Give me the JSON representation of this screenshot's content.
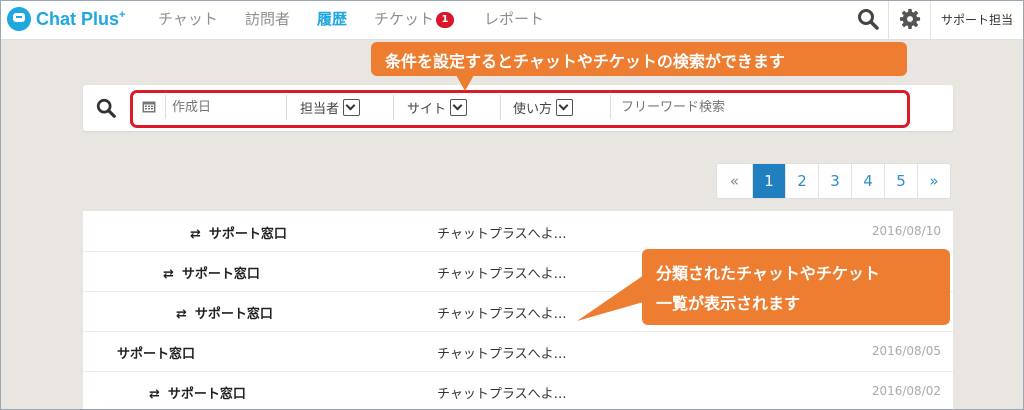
{
  "nav": {
    "logo": "Chat Plus",
    "logo_plus": "+",
    "items": [
      {
        "label": "チャット"
      },
      {
        "label": "訪問者"
      },
      {
        "label": "履歴"
      },
      {
        "label": "チケット",
        "badge": "1"
      },
      {
        "label": "レポート"
      }
    ],
    "active_item": "履歴",
    "user_label": "サポート担当",
    "colors": {
      "brand": "#1fa7e0",
      "badge": "#d9162c"
    }
  },
  "search": {
    "date_placeholder": "作成日",
    "filters": [
      {
        "label": "担当者"
      },
      {
        "label": "サイト"
      },
      {
        "label": "使い方"
      }
    ],
    "freeword_placeholder": "フリーワード検索",
    "highlight_color": "#d81b27"
  },
  "callouts": {
    "top": "条件を設定するとチャットやチケットの検索ができます",
    "right_line1": "分類されたチャットやチケット",
    "right_line2": "一覧が表示されます",
    "color": "#ed7d31"
  },
  "pagination": {
    "prev": "«",
    "pages": [
      "1",
      "2",
      "3",
      "4",
      "5"
    ],
    "current": "1",
    "next": "»"
  },
  "list": {
    "rows": [
      {
        "swap": "⇄",
        "name": "サポート窓口",
        "message": "チャットプラスへよ…",
        "date": "2016/08/10"
      },
      {
        "swap": "⇄",
        "name": "サポート窓口",
        "message": "チャットプラスへよ…",
        "date": ""
      },
      {
        "swap": "⇄",
        "name": "サポート窓口",
        "message": "チャットプラスへよ…",
        "date": ""
      },
      {
        "swap": "",
        "name": "サポート窓口",
        "message": "チャットプラスへよ…",
        "date": "2016/08/05"
      },
      {
        "swap": "⇄",
        "name": "サポート窓口",
        "message": "チャットプラスへよ…",
        "date": "2016/08/02"
      }
    ]
  }
}
